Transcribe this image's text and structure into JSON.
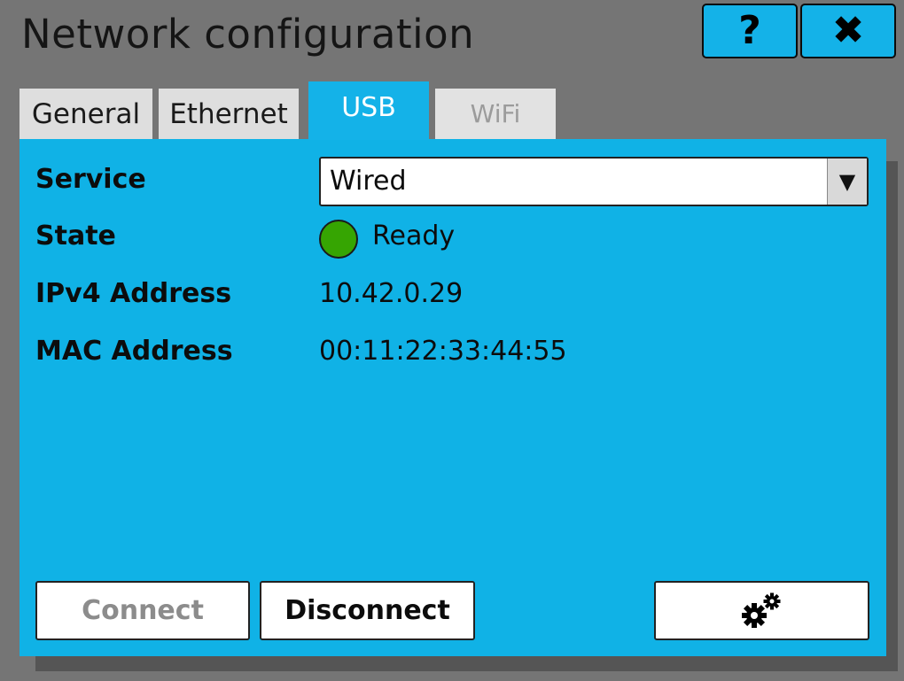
{
  "window": {
    "title": "Network configuration"
  },
  "header": {
    "help_glyph": "?",
    "close_glyph": "✖"
  },
  "tabs": [
    {
      "label": "General",
      "state": "inactive"
    },
    {
      "label": "Ethernet",
      "state": "inactive"
    },
    {
      "label": "USB",
      "state": "active"
    },
    {
      "label": "WiFi",
      "state": "disabled"
    }
  ],
  "fields": {
    "service": {
      "label": "Service",
      "value": "Wired",
      "dropdown_glyph": "▼"
    },
    "state": {
      "label": "State",
      "value": "Ready",
      "indicator_color": "#36a502"
    },
    "ipv4": {
      "label": "IPv4 Address",
      "value": "10.42.0.29"
    },
    "mac": {
      "label": "MAC Address",
      "value": "00:11:22:33:44:55"
    }
  },
  "buttons": {
    "connect": {
      "label": "Connect",
      "enabled": false
    },
    "disconnect": {
      "label": "Disconnect",
      "enabled": true
    },
    "settings": {
      "icon": "gears-icon"
    }
  },
  "colors": {
    "accent": "#14b2e8",
    "background": "#757575",
    "tab_inactive": "#dedede",
    "disabled_text": "#8c8c8c"
  }
}
